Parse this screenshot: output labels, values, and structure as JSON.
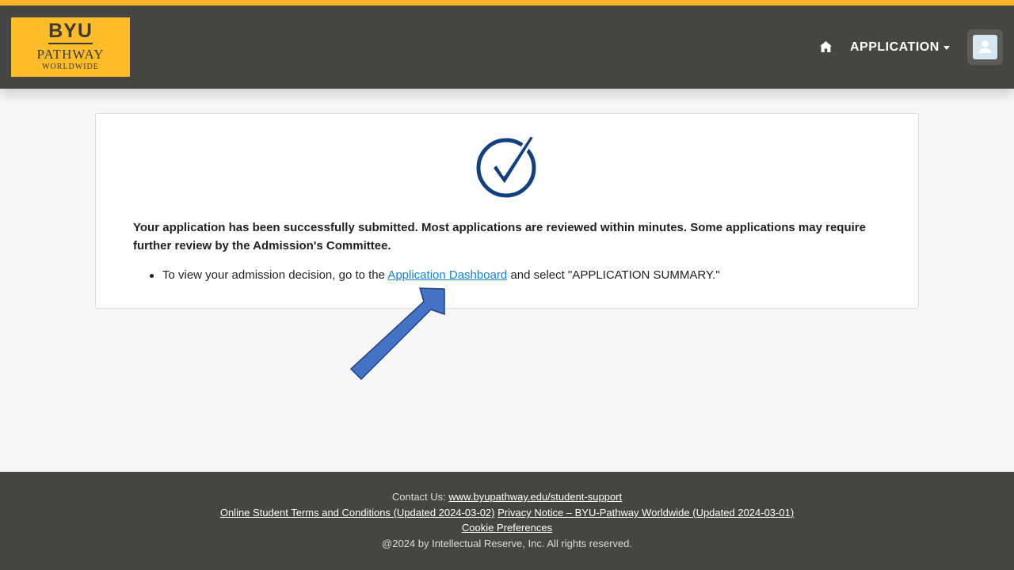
{
  "header": {
    "logo": {
      "line1": "BYU",
      "line2": "PATHWAY",
      "line3": "WORLDWIDE"
    },
    "home_icon": "home-icon",
    "menu_label": "APPLICATION",
    "user_icon": "user-avatar-icon"
  },
  "colors": {
    "accent": "#fdb827",
    "header_bg": "#454542",
    "check": "#123f7d",
    "link": "#1a7fce",
    "arrow_fill": "#4472c4"
  },
  "main": {
    "status_icon": "checkmark-circle-icon",
    "message": "Your application has been successfully submitted. Most applications are reviewed within minutes. Some applications may require further review by the Admission's Committee.",
    "bullet": {
      "prefix": "To view your admission decision, go to the",
      "link": "Application Dashboard",
      "suffix": "and select \"APPLICATION SUMMARY.\""
    }
  },
  "footer": {
    "contact_prefix": "Contact Us:",
    "contact_link": "www.byupathway.edu/student-support",
    "terms_link": "Online Student Terms and Conditions (Updated 2024-03-02)",
    "privacy_link": "Privacy Notice – BYU-Pathway Worldwide (Updated 2024-03-01)",
    "cookie_link": "Cookie Preferences",
    "copyright": "@2024 by Intellectual Reserve, Inc. All rights reserved."
  }
}
